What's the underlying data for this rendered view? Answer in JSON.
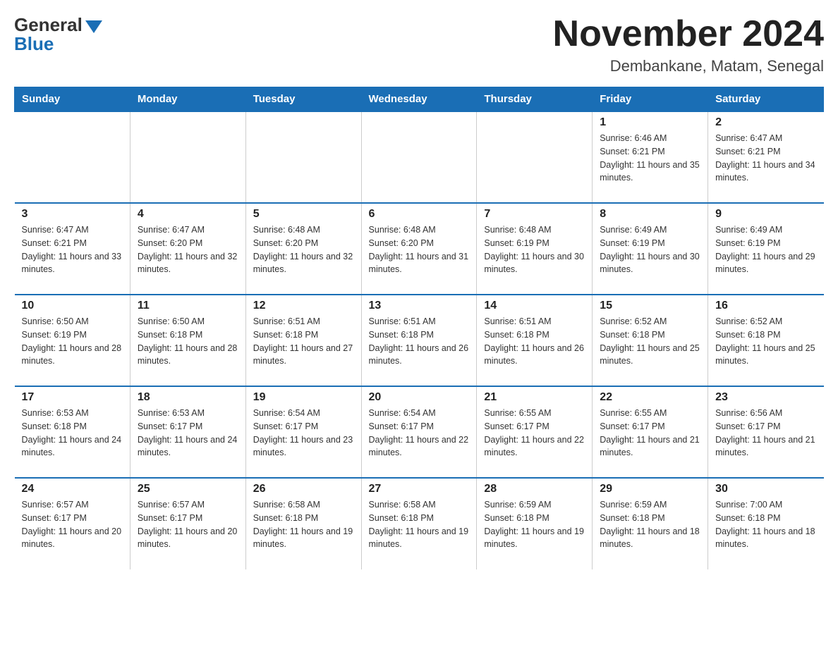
{
  "logo": {
    "general": "General",
    "blue": "Blue"
  },
  "title": "November 2024",
  "subtitle": "Dembankane, Matam, Senegal",
  "days_of_week": [
    "Sunday",
    "Monday",
    "Tuesday",
    "Wednesday",
    "Thursday",
    "Friday",
    "Saturday"
  ],
  "weeks": [
    [
      {
        "day": "",
        "sunrise": "",
        "sunset": "",
        "daylight": ""
      },
      {
        "day": "",
        "sunrise": "",
        "sunset": "",
        "daylight": ""
      },
      {
        "day": "",
        "sunrise": "",
        "sunset": "",
        "daylight": ""
      },
      {
        "day": "",
        "sunrise": "",
        "sunset": "",
        "daylight": ""
      },
      {
        "day": "",
        "sunrise": "",
        "sunset": "",
        "daylight": ""
      },
      {
        "day": "1",
        "sunrise": "Sunrise: 6:46 AM",
        "sunset": "Sunset: 6:21 PM",
        "daylight": "Daylight: 11 hours and 35 minutes."
      },
      {
        "day": "2",
        "sunrise": "Sunrise: 6:47 AM",
        "sunset": "Sunset: 6:21 PM",
        "daylight": "Daylight: 11 hours and 34 minutes."
      }
    ],
    [
      {
        "day": "3",
        "sunrise": "Sunrise: 6:47 AM",
        "sunset": "Sunset: 6:21 PM",
        "daylight": "Daylight: 11 hours and 33 minutes."
      },
      {
        "day": "4",
        "sunrise": "Sunrise: 6:47 AM",
        "sunset": "Sunset: 6:20 PM",
        "daylight": "Daylight: 11 hours and 32 minutes."
      },
      {
        "day": "5",
        "sunrise": "Sunrise: 6:48 AM",
        "sunset": "Sunset: 6:20 PM",
        "daylight": "Daylight: 11 hours and 32 minutes."
      },
      {
        "day": "6",
        "sunrise": "Sunrise: 6:48 AM",
        "sunset": "Sunset: 6:20 PM",
        "daylight": "Daylight: 11 hours and 31 minutes."
      },
      {
        "day": "7",
        "sunrise": "Sunrise: 6:48 AM",
        "sunset": "Sunset: 6:19 PM",
        "daylight": "Daylight: 11 hours and 30 minutes."
      },
      {
        "day": "8",
        "sunrise": "Sunrise: 6:49 AM",
        "sunset": "Sunset: 6:19 PM",
        "daylight": "Daylight: 11 hours and 30 minutes."
      },
      {
        "day": "9",
        "sunrise": "Sunrise: 6:49 AM",
        "sunset": "Sunset: 6:19 PM",
        "daylight": "Daylight: 11 hours and 29 minutes."
      }
    ],
    [
      {
        "day": "10",
        "sunrise": "Sunrise: 6:50 AM",
        "sunset": "Sunset: 6:19 PM",
        "daylight": "Daylight: 11 hours and 28 minutes."
      },
      {
        "day": "11",
        "sunrise": "Sunrise: 6:50 AM",
        "sunset": "Sunset: 6:18 PM",
        "daylight": "Daylight: 11 hours and 28 minutes."
      },
      {
        "day": "12",
        "sunrise": "Sunrise: 6:51 AM",
        "sunset": "Sunset: 6:18 PM",
        "daylight": "Daylight: 11 hours and 27 minutes."
      },
      {
        "day": "13",
        "sunrise": "Sunrise: 6:51 AM",
        "sunset": "Sunset: 6:18 PM",
        "daylight": "Daylight: 11 hours and 26 minutes."
      },
      {
        "day": "14",
        "sunrise": "Sunrise: 6:51 AM",
        "sunset": "Sunset: 6:18 PM",
        "daylight": "Daylight: 11 hours and 26 minutes."
      },
      {
        "day": "15",
        "sunrise": "Sunrise: 6:52 AM",
        "sunset": "Sunset: 6:18 PM",
        "daylight": "Daylight: 11 hours and 25 minutes."
      },
      {
        "day": "16",
        "sunrise": "Sunrise: 6:52 AM",
        "sunset": "Sunset: 6:18 PM",
        "daylight": "Daylight: 11 hours and 25 minutes."
      }
    ],
    [
      {
        "day": "17",
        "sunrise": "Sunrise: 6:53 AM",
        "sunset": "Sunset: 6:18 PM",
        "daylight": "Daylight: 11 hours and 24 minutes."
      },
      {
        "day": "18",
        "sunrise": "Sunrise: 6:53 AM",
        "sunset": "Sunset: 6:17 PM",
        "daylight": "Daylight: 11 hours and 24 minutes."
      },
      {
        "day": "19",
        "sunrise": "Sunrise: 6:54 AM",
        "sunset": "Sunset: 6:17 PM",
        "daylight": "Daylight: 11 hours and 23 minutes."
      },
      {
        "day": "20",
        "sunrise": "Sunrise: 6:54 AM",
        "sunset": "Sunset: 6:17 PM",
        "daylight": "Daylight: 11 hours and 22 minutes."
      },
      {
        "day": "21",
        "sunrise": "Sunrise: 6:55 AM",
        "sunset": "Sunset: 6:17 PM",
        "daylight": "Daylight: 11 hours and 22 minutes."
      },
      {
        "day": "22",
        "sunrise": "Sunrise: 6:55 AM",
        "sunset": "Sunset: 6:17 PM",
        "daylight": "Daylight: 11 hours and 21 minutes."
      },
      {
        "day": "23",
        "sunrise": "Sunrise: 6:56 AM",
        "sunset": "Sunset: 6:17 PM",
        "daylight": "Daylight: 11 hours and 21 minutes."
      }
    ],
    [
      {
        "day": "24",
        "sunrise": "Sunrise: 6:57 AM",
        "sunset": "Sunset: 6:17 PM",
        "daylight": "Daylight: 11 hours and 20 minutes."
      },
      {
        "day": "25",
        "sunrise": "Sunrise: 6:57 AM",
        "sunset": "Sunset: 6:17 PM",
        "daylight": "Daylight: 11 hours and 20 minutes."
      },
      {
        "day": "26",
        "sunrise": "Sunrise: 6:58 AM",
        "sunset": "Sunset: 6:18 PM",
        "daylight": "Daylight: 11 hours and 19 minutes."
      },
      {
        "day": "27",
        "sunrise": "Sunrise: 6:58 AM",
        "sunset": "Sunset: 6:18 PM",
        "daylight": "Daylight: 11 hours and 19 minutes."
      },
      {
        "day": "28",
        "sunrise": "Sunrise: 6:59 AM",
        "sunset": "Sunset: 6:18 PM",
        "daylight": "Daylight: 11 hours and 19 minutes."
      },
      {
        "day": "29",
        "sunrise": "Sunrise: 6:59 AM",
        "sunset": "Sunset: 6:18 PM",
        "daylight": "Daylight: 11 hours and 18 minutes."
      },
      {
        "day": "30",
        "sunrise": "Sunrise: 7:00 AM",
        "sunset": "Sunset: 6:18 PM",
        "daylight": "Daylight: 11 hours and 18 minutes."
      }
    ]
  ]
}
